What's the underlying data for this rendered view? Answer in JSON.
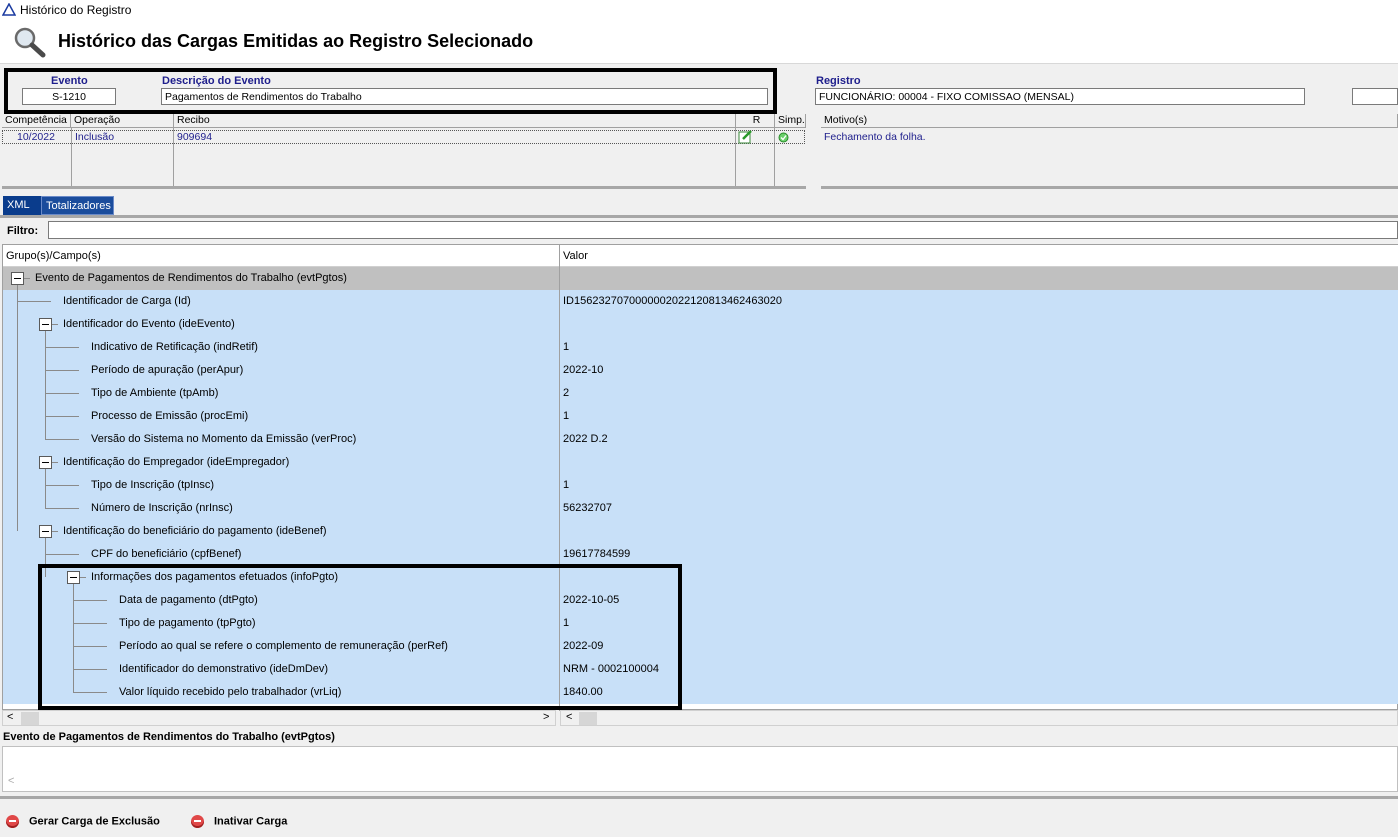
{
  "window": {
    "title": "Histórico do Registro"
  },
  "header": {
    "title": "Histórico das Cargas Emitidas ao Registro Selecionado"
  },
  "fields": {
    "evento_label": "Evento",
    "evento_value": "S-1210",
    "descricao_label": "Descrição do Evento",
    "descricao_value": "Pagamentos de Rendimentos do Trabalho",
    "registro_label": "Registro",
    "registro_value": "FUNCIONÁRIO: 00004 - FIXO COMISSAO (MENSAL)"
  },
  "grid": {
    "columns": [
      "Competência",
      "Operação",
      "Recibo",
      "R",
      "Simp."
    ],
    "rows": [
      {
        "competencia": "10/2022",
        "operacao": "Inclusão",
        "recibo": "909694"
      }
    ],
    "motivo_header": "Motivo(s)",
    "motivo_value": "Fechamento da folha."
  },
  "tabs": [
    "XML",
    "Totalizadores"
  ],
  "filter": {
    "label": "Filtro:",
    "value": ""
  },
  "tree": {
    "columns": [
      "Grupo(s)/Campo(s)",
      "Valor"
    ],
    "rows": [
      {
        "label": "Evento de Pagamentos de Rendimentos do Trabalho (evtPgtos)",
        "value": ""
      },
      {
        "label": "Identificador de Carga (Id)",
        "value": "ID1562327070000002022120813462463020"
      },
      {
        "label": "Identificador do Evento (ideEvento)",
        "value": ""
      },
      {
        "label": "Indicativo de Retificação (indRetif)",
        "value": "1"
      },
      {
        "label": "Período de apuração (perApur)",
        "value": "2022-10"
      },
      {
        "label": "Tipo de Ambiente (tpAmb)",
        "value": "2"
      },
      {
        "label": "Processo de Emissão (procEmi)",
        "value": "1"
      },
      {
        "label": "Versão do Sistema no Momento da Emissão (verProc)",
        "value": "2022 D.2"
      },
      {
        "label": "Identificação do Empregador (ideEmpregador)",
        "value": ""
      },
      {
        "label": "Tipo de Inscrição (tpInsc)",
        "value": "1"
      },
      {
        "label": "Número de Inscrição (nrInsc)",
        "value": "56232707"
      },
      {
        "label": "Identificação do beneficiário do pagamento (ideBenef)",
        "value": ""
      },
      {
        "label": "CPF do beneficiário (cpfBenef)",
        "value": "19617784599"
      },
      {
        "label": "Informações dos pagamentos efetuados (infoPgto)",
        "value": ""
      },
      {
        "label": "Data de pagamento (dtPgto)",
        "value": "2022-10-05"
      },
      {
        "label": "Tipo de pagamento (tpPgto)",
        "value": "1"
      },
      {
        "label": "Período ao qual se refere o complemento de remuneração (perRef)",
        "value": "2022-09"
      },
      {
        "label": "Identificador do demonstrativo (ideDmDev)",
        "value": "NRM - 0002100004"
      },
      {
        "label": "Valor líquido recebido pelo trabalhador (vrLiq)",
        "value": "1840.00"
      }
    ]
  },
  "footer": {
    "label": "Evento de Pagamentos de Rendimentos do Trabalho (evtPgtos)"
  },
  "buttons": {
    "gerar": "Gerar Carga de Exclusão",
    "inativar": "Inativar Carga"
  },
  "colors": {
    "row_blue": "#c8e0f8",
    "tab_blue": "#0a3c8c",
    "label_blue": "#1e1e8c"
  },
  "icons": [
    "warning-icon",
    "magnifier-icon",
    "edit-icon",
    "check-icon",
    "minus-circle-icon"
  ]
}
